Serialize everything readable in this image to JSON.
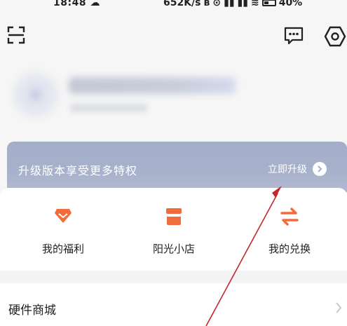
{
  "status_bar": {
    "time": "18:48",
    "net_speed": "652K/s",
    "battery": "40%"
  },
  "header": {
    "left_icon": "scan-icon",
    "right_icons": [
      "message-icon",
      "settings-icon"
    ]
  },
  "vip": {
    "title": "升级版本享受更多特权",
    "upgrade_label": "立即升级",
    "accent": "#a8b1cb"
  },
  "quick_actions": [
    {
      "label": "我的福利",
      "icon": "gift-diamond-icon",
      "color": "#f26b3a"
    },
    {
      "label": "阳光小店",
      "icon": "shop-icon",
      "color": "#f26b3a"
    },
    {
      "label": "我的兑换",
      "icon": "exchange-icon",
      "color": "#f26b3a"
    }
  ],
  "menu": {
    "items": [
      {
        "label": "硬件商城",
        "icon": "chevron-right-icon"
      }
    ]
  },
  "colors": {
    "annotation_arrow": "#c0282d",
    "brand_orange": "#f26b3a"
  }
}
